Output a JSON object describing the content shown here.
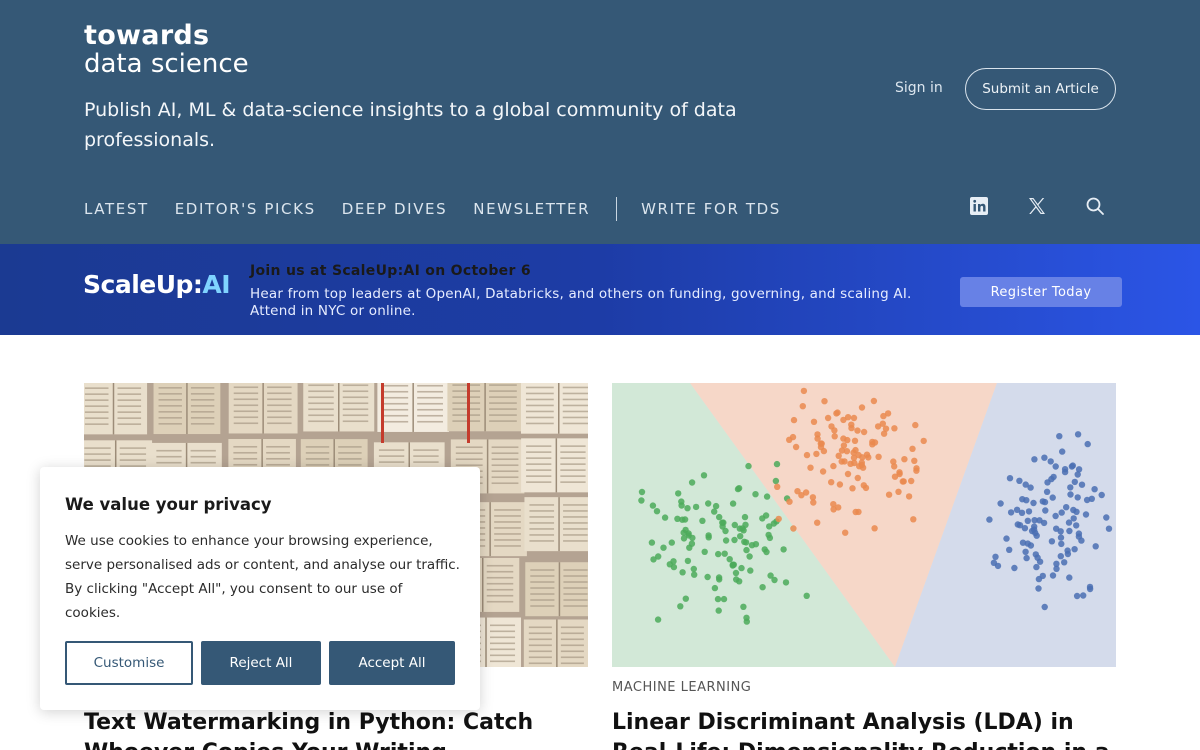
{
  "header": {
    "logo_line1": "towards",
    "logo_line2": "data science",
    "tagline": "Publish AI, ML & data-science insights to a global community of data professionals.",
    "signin_label": "Sign in",
    "submit_label": "Submit an Article",
    "nav": [
      "LATEST",
      "EDITOR'S PICKS",
      "DEEP DIVES",
      "NEWSLETTER"
    ],
    "nav_write": "WRITE FOR TDS",
    "icons": [
      "linkedin-icon",
      "x-icon",
      "search-icon"
    ],
    "color": "#355876"
  },
  "banner": {
    "logo_main": "ScaleUp:",
    "logo_ai": "AI",
    "title": "Join us at ScaleUp:AI on October 6",
    "description": "Hear from top leaders at OpenAI, Databricks, and others on funding, governing, and scaling AI. Attend in NYC or online.",
    "cta": "Register Today"
  },
  "articles": [
    {
      "category": "",
      "title": "Text Watermarking in Python: Catch Whoever Copies Your Writing"
    },
    {
      "category": "MACHINE LEARNING",
      "title": "Linear Discriminant Analysis (LDA) in Real-Life: Dimensionality Reduction in a"
    }
  ],
  "cookie": {
    "title": "We value your privacy",
    "text": "We use cookies to enhance your browsing experience, serve personalised ads or content, and analyse our traffic. By clicking \"Accept All\", you consent to our use of cookies.",
    "customise": "Customise",
    "reject": "Reject All",
    "accept": "Accept All"
  }
}
